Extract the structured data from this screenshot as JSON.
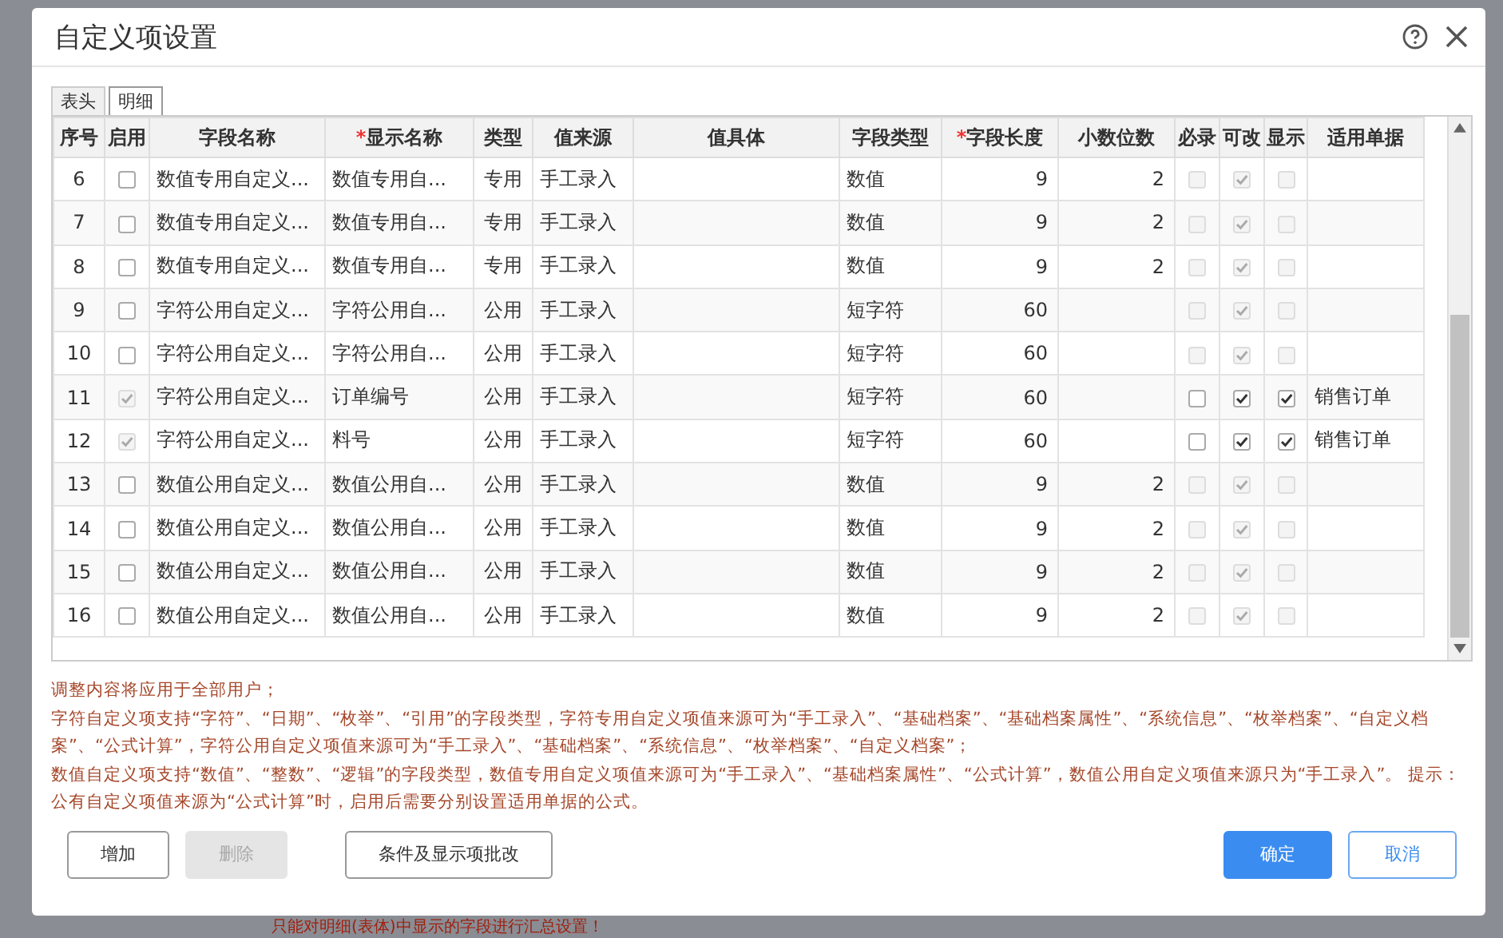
{
  "window": {
    "title": "自定义项设置"
  },
  "tabs": [
    {
      "label": "表头",
      "selected": false
    },
    {
      "label": "明细",
      "selected": true
    }
  ],
  "table": {
    "columns": [
      {
        "label": "序号"
      },
      {
        "label": "启用"
      },
      {
        "label": "字段名称"
      },
      {
        "label": "显示名称",
        "marker": "*"
      },
      {
        "label": "类型"
      },
      {
        "label": "值来源"
      },
      {
        "label": "值具体"
      },
      {
        "label": "字段类型"
      },
      {
        "label": "字段长度",
        "marker": "*"
      },
      {
        "label": "小数位数"
      },
      {
        "label": "必录"
      },
      {
        "label": "可改"
      },
      {
        "label": "显示"
      },
      {
        "label": "适用单据"
      }
    ],
    "rows": [
      {
        "no": "6",
        "enabled": {
          "checked": false,
          "disabled": false
        },
        "field_name": "数值专用自定义...",
        "display_name": "数值专用自...",
        "type": "专用",
        "source": "手工录入",
        "field_type": "数值",
        "length": "9",
        "decimals": "2",
        "must": {
          "checked": false,
          "disabled": true
        },
        "editable": {
          "checked": true,
          "disabled": true
        },
        "shown": {
          "checked": false,
          "disabled": true
        }
      },
      {
        "no": "7",
        "enabled": {
          "checked": false,
          "disabled": false
        },
        "field_name": "数值专用自定义...",
        "display_name": "数值专用自...",
        "type": "专用",
        "source": "手工录入",
        "field_type": "数值",
        "length": "9",
        "decimals": "2",
        "must": {
          "checked": false,
          "disabled": true
        },
        "editable": {
          "checked": true,
          "disabled": true
        },
        "shown": {
          "checked": false,
          "disabled": true
        }
      },
      {
        "no": "8",
        "enabled": {
          "checked": false,
          "disabled": false
        },
        "field_name": "数值专用自定义...",
        "display_name": "数值专用自...",
        "type": "专用",
        "source": "手工录入",
        "field_type": "数值",
        "length": "9",
        "decimals": "2",
        "must": {
          "checked": false,
          "disabled": true
        },
        "editable": {
          "checked": true,
          "disabled": true
        },
        "shown": {
          "checked": false,
          "disabled": true
        }
      },
      {
        "no": "9",
        "enabled": {
          "checked": false,
          "disabled": false
        },
        "field_name": "字符公用自定义...",
        "display_name": "字符公用自...",
        "type": "公用",
        "source": "手工录入",
        "field_type": "短字符",
        "length": "60",
        "must": {
          "checked": false,
          "disabled": true
        },
        "editable": {
          "checked": true,
          "disabled": true
        },
        "shown": {
          "checked": false,
          "disabled": true
        }
      },
      {
        "no": "10",
        "enabled": {
          "checked": false,
          "disabled": false
        },
        "field_name": "字符公用自定义...",
        "display_name": "字符公用自...",
        "type": "公用",
        "source": "手工录入",
        "field_type": "短字符",
        "length": "60",
        "must": {
          "checked": false,
          "disabled": true
        },
        "editable": {
          "checked": true,
          "disabled": true
        },
        "shown": {
          "checked": false,
          "disabled": true
        }
      },
      {
        "no": "11",
        "enabled": {
          "checked": true,
          "disabled": true
        },
        "field_name": "字符公用自定义...",
        "display_name": "订单编号",
        "type": "公用",
        "source": "手工录入",
        "field_type": "短字符",
        "length": "60",
        "must": {
          "checked": false,
          "disabled": false
        },
        "editable": {
          "checked": true,
          "disabled": false
        },
        "shown": {
          "checked": true,
          "disabled": false
        },
        "document": "销售订单"
      },
      {
        "no": "12",
        "enabled": {
          "checked": true,
          "disabled": true
        },
        "field_name": "字符公用自定义...",
        "display_name": "料号",
        "type": "公用",
        "source": "手工录入",
        "field_type": "短字符",
        "length": "60",
        "must": {
          "checked": false,
          "disabled": false
        },
        "editable": {
          "checked": true,
          "disabled": false
        },
        "shown": {
          "checked": true,
          "disabled": false
        },
        "document": "销售订单"
      },
      {
        "no": "13",
        "enabled": {
          "checked": false,
          "disabled": false
        },
        "field_name": "数值公用自定义...",
        "display_name": "数值公用自...",
        "type": "公用",
        "source": "手工录入",
        "field_type": "数值",
        "length": "9",
        "decimals": "2",
        "must": {
          "checked": false,
          "disabled": true
        },
        "editable": {
          "checked": true,
          "disabled": true
        },
        "shown": {
          "checked": false,
          "disabled": true
        }
      },
      {
        "no": "14",
        "enabled": {
          "checked": false,
          "disabled": false
        },
        "field_name": "数值公用自定义...",
        "display_name": "数值公用自...",
        "type": "公用",
        "source": "手工录入",
        "field_type": "数值",
        "length": "9",
        "decimals": "2",
        "must": {
          "checked": false,
          "disabled": true
        },
        "editable": {
          "checked": true,
          "disabled": true
        },
        "shown": {
          "checked": false,
          "disabled": true
        }
      },
      {
        "no": "15",
        "enabled": {
          "checked": false,
          "disabled": false
        },
        "field_name": "数值公用自定义...",
        "display_name": "数值公用自...",
        "type": "公用",
        "source": "手工录入",
        "field_type": "数值",
        "length": "9",
        "decimals": "2",
        "must": {
          "checked": false,
          "disabled": true
        },
        "editable": {
          "checked": true,
          "disabled": true
        },
        "shown": {
          "checked": false,
          "disabled": true
        }
      },
      {
        "no": "16",
        "enabled": {
          "checked": false,
          "disabled": false
        },
        "field_name": "数值公用自定义...",
        "display_name": "数值公用自...",
        "type": "公用",
        "source": "手工录入",
        "field_type": "数值",
        "length": "9",
        "decimals": "2",
        "must": {
          "checked": false,
          "disabled": true
        },
        "editable": {
          "checked": true,
          "disabled": true
        },
        "shown": {
          "checked": false,
          "disabled": true
        }
      }
    ]
  },
  "notes": [
    "调整内容将应用于全部用户；",
    "字符自定义项支持“字符”、“日期”、“枚举”、“引用”的字段类型，字符专用自定义项值来源可为“手工录入”、“基础档案”、“基础档案属性”、“系统信息”、“枚举档案”、“自定义档案”、“公式计算”，字符公用自定义项值来源可为“手工录入”、“基础档案”、“系统信息”、“枚举档案”、“自定义档案”；",
    "数值自定义项支持“数值”、“整数”、“逻辑”的字段类型，数值专用自定义项值来源可为“手工录入”、“基础档案属性”、“公式计算”，数值公用自定义项值来源只为“手工录入”。 提示：公有自定义项值来源为“公式计算”时，启用后需要分别设置适用单据的公式。"
  ],
  "buttons": [
    {
      "label": "增加",
      "kind": "plain",
      "disabled": false
    },
    {
      "label": "删除",
      "kind": "plain",
      "disabled": true
    },
    {
      "label": "条件及显示项批改",
      "kind": "plain",
      "disabled": false
    },
    {
      "label": "确定",
      "kind": "primary",
      "disabled": false
    },
    {
      "label": "取消",
      "kind": "secondary",
      "disabled": false
    }
  ],
  "background_note": "只能对明细(表体)中显示的字段进行汇总设置！"
}
